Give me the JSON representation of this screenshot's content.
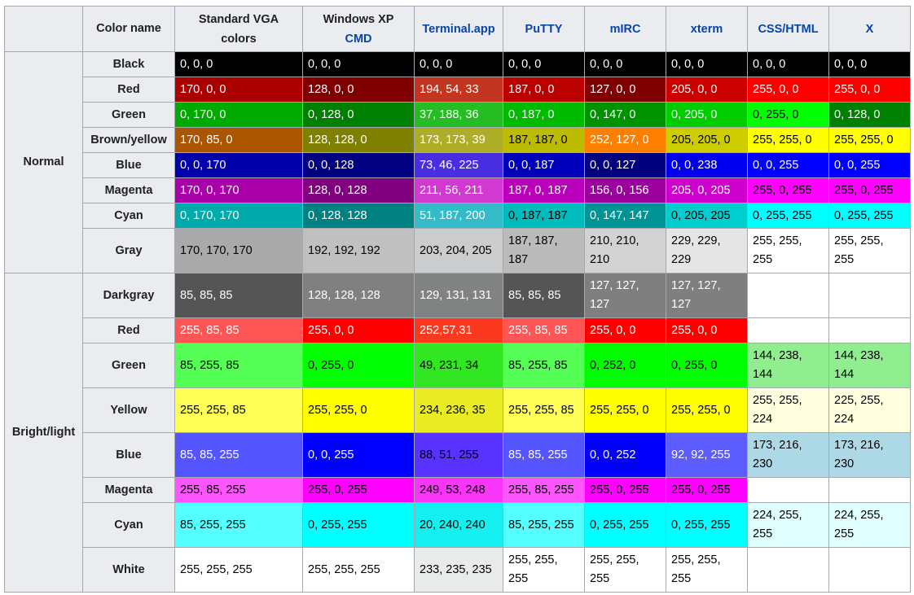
{
  "header": {
    "corner": "",
    "color_name": "Color name",
    "columns": [
      {
        "line1": "Standard VGA",
        "line2": "colors",
        "link": false
      },
      {
        "line1": "Windows XP",
        "line2": "CMD",
        "link": true,
        "link_line": 2
      },
      {
        "line1": "Terminal.app",
        "line2": "",
        "link": true,
        "link_line": 1
      },
      {
        "line1": "PuTTY",
        "line2": "",
        "link": true,
        "link_line": 1
      },
      {
        "line1": "mIRC",
        "line2": "",
        "link": true,
        "link_line": 1
      },
      {
        "line1": "xterm",
        "line2": "",
        "link": true,
        "link_line": 1
      },
      {
        "line1": "CSS/HTML",
        "line2": "",
        "link": true,
        "link_line": 1
      },
      {
        "line1": "X",
        "line2": "",
        "link": true,
        "link_line": 1
      }
    ]
  },
  "groups": [
    {
      "label": "Normal",
      "rows": [
        {
          "name": "Black",
          "height": 31,
          "cells": [
            {
              "t": "0, 0, 0",
              "bg": "#000000",
              "fg": "#ffffff"
            },
            {
              "t": "0, 0, 0",
              "bg": "#000000",
              "fg": "#ffffff"
            },
            {
              "t": "0, 0, 0",
              "bg": "#000000",
              "fg": "#ffffff"
            },
            {
              "t": "0, 0, 0",
              "bg": "#000000",
              "fg": "#ffffff"
            },
            {
              "t": "0, 0, 0",
              "bg": "#000000",
              "fg": "#ffffff"
            },
            {
              "t": "0, 0, 0",
              "bg": "#000000",
              "fg": "#ffffff"
            },
            {
              "t": "0, 0, 0",
              "bg": "#000000",
              "fg": "#ffffff"
            },
            {
              "t": "0, 0, 0",
              "bg": "#000000",
              "fg": "#ffffff"
            }
          ]
        },
        {
          "name": "Red",
          "height": 31,
          "cells": [
            {
              "t": "170, 0, 0",
              "bg": "#aa0000",
              "fg": "#ffffff"
            },
            {
              "t": "128, 0, 0",
              "bg": "#800000",
              "fg": "#ffffff"
            },
            {
              "t": "194, 54, 33",
              "bg": "#c23621",
              "fg": "#ffffff"
            },
            {
              "t": "187, 0, 0",
              "bg": "#bb0000",
              "fg": "#ffffff"
            },
            {
              "t": "127, 0, 0",
              "bg": "#7f0000",
              "fg": "#ffffff"
            },
            {
              "t": "205, 0, 0",
              "bg": "#cd0000",
              "fg": "#ffffff"
            },
            {
              "t": "255, 0, 0",
              "bg": "#ff0000",
              "fg": "#ffffff"
            },
            {
              "t": "255, 0, 0",
              "bg": "#ff0000",
              "fg": "#ffffff"
            }
          ]
        },
        {
          "name": "Green",
          "height": 31,
          "cells": [
            {
              "t": "0, 170, 0",
              "bg": "#00aa00",
              "fg": "#ffffff"
            },
            {
              "t": "0, 128, 0",
              "bg": "#008000",
              "fg": "#ffffff"
            },
            {
              "t": "37, 188, 36",
              "bg": "#25bc24",
              "fg": "#ffffff"
            },
            {
              "t": "0, 187, 0",
              "bg": "#00bb00",
              "fg": "#ffffff"
            },
            {
              "t": "0, 147, 0",
              "bg": "#009300",
              "fg": "#ffffff"
            },
            {
              "t": "0, 205, 0",
              "bg": "#00cd00",
              "fg": "#ffffff"
            },
            {
              "t": "0, 255, 0",
              "bg": "#00ff00",
              "fg": "#000000"
            },
            {
              "t": "0, 128, 0",
              "bg": "#008000",
              "fg": "#ffffff"
            }
          ]
        },
        {
          "name": "Brown/yellow",
          "height": 31,
          "cells": [
            {
              "t": "170, 85, 0",
              "bg": "#aa5500",
              "fg": "#ffffff"
            },
            {
              "t": "128, 128, 0",
              "bg": "#808000",
              "fg": "#ffffff"
            },
            {
              "t": "173, 173, 39",
              "bg": "#adad27",
              "fg": "#ffffff"
            },
            {
              "t": "187, 187, 0",
              "bg": "#bbbb00",
              "fg": "#000000"
            },
            {
              "t": "252, 127, 0",
              "bg": "#fc7f00",
              "fg": "#ffffff"
            },
            {
              "t": "205, 205, 0",
              "bg": "#cdcd00",
              "fg": "#000000"
            },
            {
              "t": "255, 255, 0",
              "bg": "#ffff00",
              "fg": "#000000"
            },
            {
              "t": "255, 255, 0",
              "bg": "#ffff00",
              "fg": "#000000"
            }
          ]
        },
        {
          "name": "Blue",
          "height": 31,
          "cells": [
            {
              "t": "0, 0, 170",
              "bg": "#0000aa",
              "fg": "#ffffff"
            },
            {
              "t": "0, 0, 128",
              "bg": "#000080",
              "fg": "#ffffff"
            },
            {
              "t": "73, 46, 225",
              "bg": "#492ee1",
              "fg": "#ffffff"
            },
            {
              "t": "0, 0, 187",
              "bg": "#0000bb",
              "fg": "#ffffff"
            },
            {
              "t": "0, 0, 127",
              "bg": "#00007f",
              "fg": "#ffffff"
            },
            {
              "t": "0, 0, 238",
              "bg": "#0000ee",
              "fg": "#ffffff"
            },
            {
              "t": "0, 0, 255",
              "bg": "#0000ff",
              "fg": "#ffffff"
            },
            {
              "t": "0, 0, 255",
              "bg": "#0000ff",
              "fg": "#ffffff"
            }
          ]
        },
        {
          "name": "Magenta",
          "height": 31,
          "cells": [
            {
              "t": "170, 0, 170",
              "bg": "#aa00aa",
              "fg": "#ffffff"
            },
            {
              "t": "128, 0, 128",
              "bg": "#800080",
              "fg": "#ffffff"
            },
            {
              "t": "211, 56, 211",
              "bg": "#d338d3",
              "fg": "#ffffff"
            },
            {
              "t": "187, 0, 187",
              "bg": "#bb00bb",
              "fg": "#ffffff"
            },
            {
              "t": "156, 0, 156",
              "bg": "#9c009c",
              "fg": "#ffffff"
            },
            {
              "t": "205, 0, 205",
              "bg": "#cd00cd",
              "fg": "#ffffff"
            },
            {
              "t": "255, 0, 255",
              "bg": "#ff00ff",
              "fg": "#000000"
            },
            {
              "t": "255, 0, 255",
              "bg": "#ff00ff",
              "fg": "#000000"
            }
          ]
        },
        {
          "name": "Cyan",
          "height": 31,
          "cells": [
            {
              "t": "0, 170, 170",
              "bg": "#00aaaa",
              "fg": "#ffffff"
            },
            {
              "t": "0, 128, 128",
              "bg": "#008080",
              "fg": "#ffffff"
            },
            {
              "t": "51, 187, 200",
              "bg": "#33bbc8",
              "fg": "#ffffff"
            },
            {
              "t": "0, 187, 187",
              "bg": "#00bbbb",
              "fg": "#000000"
            },
            {
              "t": "0, 147, 147",
              "bg": "#009393",
              "fg": "#ffffff"
            },
            {
              "t": "0, 205, 205",
              "bg": "#00cdcd",
              "fg": "#000000"
            },
            {
              "t": "0, 255, 255",
              "bg": "#00ffff",
              "fg": "#000000"
            },
            {
              "t": "0, 255, 255",
              "bg": "#00ffff",
              "fg": "#000000"
            }
          ]
        },
        {
          "name": "Gray",
          "height": 55,
          "cells": [
            {
              "t": "170, 170, 170",
              "bg": "#aaaaaa",
              "fg": "#000000"
            },
            {
              "t": "192, 192, 192",
              "bg": "#c0c0c0",
              "fg": "#000000"
            },
            {
              "t": "203, 204, 205",
              "bg": "#cbcccd",
              "fg": "#000000"
            },
            {
              "t": "187, 187, 187",
              "bg": "#bbbbbb",
              "fg": "#000000"
            },
            {
              "t": "210, 210, 210",
              "bg": "#d2d2d2",
              "fg": "#000000"
            },
            {
              "t": "229, 229, 229",
              "bg": "#e5e5e5",
              "fg": "#000000"
            },
            {
              "t": "255, 255, 255",
              "bg": "#ffffff",
              "fg": "#000000"
            },
            {
              "t": "255, 255, 255",
              "bg": "#ffffff",
              "fg": "#000000"
            }
          ]
        }
      ]
    },
    {
      "label": "Bright/light",
      "rows": [
        {
          "name": "Darkgray",
          "height": 55,
          "cells": [
            {
              "t": "85, 85, 85",
              "bg": "#555555",
              "fg": "#ffffff"
            },
            {
              "t": "128, 128, 128",
              "bg": "#808080",
              "fg": "#ffffff"
            },
            {
              "t": "129, 131, 131",
              "bg": "#818383",
              "fg": "#ffffff"
            },
            {
              "t": "85, 85, 85",
              "bg": "#555555",
              "fg": "#ffffff"
            },
            {
              "t": "127, 127, 127",
              "bg": "#7f7f7f",
              "fg": "#ffffff"
            },
            {
              "t": "127, 127, 127",
              "bg": "#7f7f7f",
              "fg": "#ffffff"
            },
            {
              "t": "",
              "bg": "#ffffff",
              "fg": "#000000"
            },
            {
              "t": "",
              "bg": "#ffffff",
              "fg": "#000000"
            }
          ]
        },
        {
          "name": "Red",
          "height": 31,
          "cells": [
            {
              "t": "255, 85, 85",
              "bg": "#ff5555",
              "fg": "#ffffff"
            },
            {
              "t": "255, 0, 0",
              "bg": "#ff0000",
              "fg": "#ffffff"
            },
            {
              "t": "252,57,31",
              "bg": "#fc391f",
              "fg": "#ffffff"
            },
            {
              "t": "255, 85, 85",
              "bg": "#ff5555",
              "fg": "#ffffff"
            },
            {
              "t": "255, 0, 0",
              "bg": "#ff0000",
              "fg": "#ffffff"
            },
            {
              "t": "255, 0, 0",
              "bg": "#ff0000",
              "fg": "#ffffff"
            },
            {
              "t": "",
              "bg": "#ffffff",
              "fg": "#000000"
            },
            {
              "t": "",
              "bg": "#ffffff",
              "fg": "#000000"
            }
          ]
        },
        {
          "name": "Green",
          "height": 55,
          "cells": [
            {
              "t": "85, 255, 85",
              "bg": "#55ff55",
              "fg": "#000000"
            },
            {
              "t": "0, 255, 0",
              "bg": "#00ff00",
              "fg": "#000000"
            },
            {
              "t": "49, 231, 34",
              "bg": "#31e722",
              "fg": "#000000"
            },
            {
              "t": "85, 255, 85",
              "bg": "#55ff55",
              "fg": "#000000"
            },
            {
              "t": "0, 252, 0",
              "bg": "#00fc00",
              "fg": "#000000"
            },
            {
              "t": "0, 255, 0",
              "bg": "#00ff00",
              "fg": "#000000"
            },
            {
              "t": "144, 238, 144",
              "bg": "#90ee90",
              "fg": "#000000"
            },
            {
              "t": "144, 238, 144",
              "bg": "#90ee90",
              "fg": "#000000"
            }
          ]
        },
        {
          "name": "Yellow",
          "height": 55,
          "cells": [
            {
              "t": "255, 255, 85",
              "bg": "#ffff55",
              "fg": "#000000"
            },
            {
              "t": "255, 255, 0",
              "bg": "#ffff00",
              "fg": "#000000"
            },
            {
              "t": "234, 236, 35",
              "bg": "#eaec23",
              "fg": "#000000"
            },
            {
              "t": "255, 255, 85",
              "bg": "#ffff55",
              "fg": "#000000"
            },
            {
              "t": "255, 255, 0",
              "bg": "#ffff00",
              "fg": "#000000"
            },
            {
              "t": "255, 255, 0",
              "bg": "#ffff00",
              "fg": "#000000"
            },
            {
              "t": "255, 255, 224",
              "bg": "#ffffe0",
              "fg": "#000000"
            },
            {
              "t": "225, 255, 224",
              "bg": "#ffffe0",
              "fg": "#000000"
            }
          ]
        },
        {
          "name": "Blue",
          "height": 55,
          "cells": [
            {
              "t": "85, 85, 255",
              "bg": "#5555ff",
              "fg": "#ffffff"
            },
            {
              "t": "0, 0, 255",
              "bg": "#0000ff",
              "fg": "#ffffff"
            },
            {
              "t": "88, 51, 255",
              "bg": "#5833ff",
              "fg": "#000000"
            },
            {
              "t": "85, 85, 255",
              "bg": "#5555ff",
              "fg": "#ffffff"
            },
            {
              "t": "0, 0, 252",
              "bg": "#0000fc",
              "fg": "#ffffff"
            },
            {
              "t": "92, 92, 255",
              "bg": "#5c5cff",
              "fg": "#ffffff"
            },
            {
              "t": "173, 216, 230",
              "bg": "#add8e6",
              "fg": "#000000"
            },
            {
              "t": "173, 216, 230",
              "bg": "#add8e6",
              "fg": "#000000"
            }
          ]
        },
        {
          "name": "Magenta",
          "height": 31,
          "cells": [
            {
              "t": "255, 85, 255",
              "bg": "#ff55ff",
              "fg": "#000000"
            },
            {
              "t": "255, 0, 255",
              "bg": "#ff00ff",
              "fg": "#000000"
            },
            {
              "t": "249, 53, 248",
              "bg": "#f935f8",
              "fg": "#000000"
            },
            {
              "t": "255, 85, 255",
              "bg": "#ff55ff",
              "fg": "#000000"
            },
            {
              "t": "255, 0, 255",
              "bg": "#ff00ff",
              "fg": "#000000"
            },
            {
              "t": "255, 0, 255",
              "bg": "#ff00ff",
              "fg": "#000000"
            },
            {
              "t": "",
              "bg": "#ffffff",
              "fg": "#000000"
            },
            {
              "t": "",
              "bg": "#ffffff",
              "fg": "#000000"
            }
          ]
        },
        {
          "name": "Cyan",
          "height": 55,
          "cells": [
            {
              "t": "85, 255, 255",
              "bg": "#55ffff",
              "fg": "#000000"
            },
            {
              "t": "0, 255, 255",
              "bg": "#00ffff",
              "fg": "#000000"
            },
            {
              "t": "20, 240, 240",
              "bg": "#14f0f0",
              "fg": "#000000"
            },
            {
              "t": "85, 255, 255",
              "bg": "#55ffff",
              "fg": "#000000"
            },
            {
              "t": "0, 255, 255",
              "bg": "#00ffff",
              "fg": "#000000"
            },
            {
              "t": "0, 255, 255",
              "bg": "#00ffff",
              "fg": "#000000"
            },
            {
              "t": "224, 255, 255",
              "bg": "#e0ffff",
              "fg": "#000000"
            },
            {
              "t": "224, 255, 255",
              "bg": "#e0ffff",
              "fg": "#000000"
            }
          ]
        },
        {
          "name": "White",
          "height": 55,
          "cells": [
            {
              "t": "255, 255, 255",
              "bg": "#ffffff",
              "fg": "#000000"
            },
            {
              "t": "255, 255, 255",
              "bg": "#ffffff",
              "fg": "#000000"
            },
            {
              "t": "233, 235, 235",
              "bg": "#e9ebeb",
              "fg": "#000000"
            },
            {
              "t": "255, 255, 255",
              "bg": "#ffffff",
              "fg": "#000000"
            },
            {
              "t": "255, 255, 255",
              "bg": "#ffffff",
              "fg": "#000000"
            },
            {
              "t": "255, 255, 255",
              "bg": "#ffffff",
              "fg": "#000000"
            },
            {
              "t": "",
              "bg": "#ffffff",
              "fg": "#000000"
            },
            {
              "t": "",
              "bg": "#ffffff",
              "fg": "#000000"
            }
          ]
        }
      ]
    }
  ]
}
